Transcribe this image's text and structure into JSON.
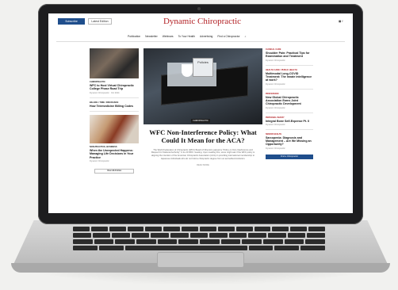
{
  "site": {
    "subscribe_label": "Subscribe",
    "latest_label": "Latest Edition",
    "logo": "Dynamic Chiropractic",
    "social": "◼ f",
    "nav": [
      "Publication",
      "Newsletter",
      "Webinars",
      "To Your Health",
      "Advertising",
      "Find a Chiropractor",
      "⌕"
    ]
  },
  "left": {
    "items": [
      {
        "tag": "CHIROPRACTIC",
        "headline": "WFC to Host Virtual Chiropractic College Phase Road Trip",
        "meta": "Dynamic Chiropractic · Oct 2024"
      },
      {
        "tag": "BILLING / TIME / INSURANCE",
        "headline": "How Telemedicine Billing Codes"
      },
      {
        "tag": "NON-PRACTICE, BUSINESS",
        "headline": "When the Unexpected Happens: Managing Life Decisions in Your Practice",
        "meta": "Dynamic Chiropractic"
      }
    ],
    "view_all": "View All Articles"
  },
  "main": {
    "image_label": "Policies",
    "tag": "CHIROPRACTIC",
    "headline": "WFC Non-Interference Policy: What Could It Mean for the ACA?",
    "body": "The World Federation of Chiropractic (WFC) Board of Directors passed a \"Policy on Non-Interference and Respect for National Authority\" in its 20 WFC meeting. Upon reading this, some might ask if the WFC policy is aligning the intention of the American Chiropractic Association (ACA) in providing international membership to Japanese individuals who do not hold a chiropractic degree from an accredited institution.",
    "read_more": "READ MORE"
  },
  "right": {
    "items": [
      {
        "tag": "CLINICAL CARE",
        "headline": "Shoulder Pain: Practical Tips for Examination and Treatment",
        "meta": "Dynamic Chiropractic"
      },
      {
        "tag": "HEALTH CARE / PUBLIC HEALTH",
        "headline": "Multimodal Long-COVID Treatment: The Innate Intelligence at work?",
        "meta": "Dynamic Chiropractic"
      },
      {
        "tag": "PROFESSION",
        "headline": "New Global Chiropractic Association Earns Joint Chiropractic Development",
        "meta": "Dynamic Chiropractic"
      },
      {
        "tag": "PERSONAL INJURY",
        "headline": "Integral Bone Self-Expense Pt. II",
        "meta": "Dynamic Chiropractic"
      },
      {
        "tag": "SENIOR HEALTH",
        "headline": "Sarcopenia: Diagnosis and Management – Are We Missing an Opportunity?",
        "meta": "Dynamic Chiropractic"
      }
    ],
    "find_label": "Find a Chiropractor"
  }
}
